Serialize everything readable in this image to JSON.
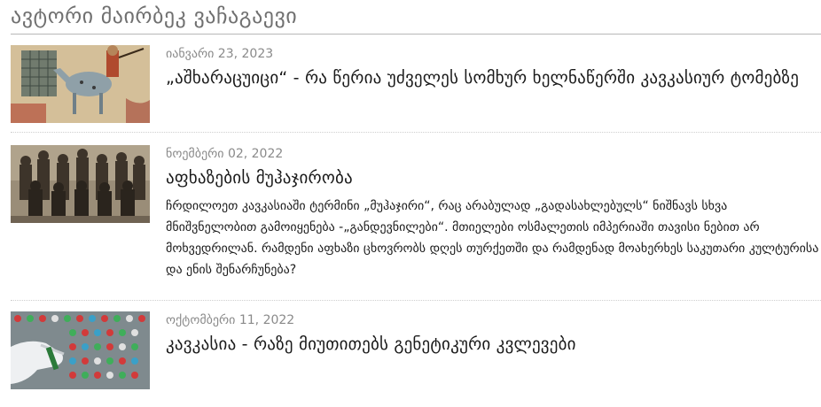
{
  "page": {
    "title": "ავტორი მაირბეკ ვაჩაგაევი"
  },
  "articles": [
    {
      "date": "იანვარი 23, 2023",
      "headline": "„აშხარაცუიცი“ - რა წერია უძველეს სომხურ ხელნაწერში კავკასიურ ტომებზე",
      "image": "manuscript-rider-illustration"
    },
    {
      "date": "ნოემბერი 02, 2022",
      "headline": "აფხაზების მუჰაჯირობა",
      "excerpt": "ჩრდილოეთ კავკასიაში ტერმინი „მუჰაჯირი“, რაც არაბულად „გადასახლებულს“ ნიშნავს სხვა მნიშვნელობით გამოიყენება -„განდევნილები“. მთიელები ოსმალეთის იმპერიაში თავისი ნებით არ მოხვედრილან. რამდენი აფხაზი ცხოვრობს დღეს თურქეთში და რამდენად მოახერხეს საკუთარი კულტურისა და ენის შენარჩუნება?",
      "image": "historic-group-photo"
    },
    {
      "date": "ოქტომბერი 11, 2022",
      "headline": "კავკასია - რაზე მიუთითებს გენეტიკური კვლევები",
      "image": "genetic-test-tubes-photo"
    }
  ]
}
